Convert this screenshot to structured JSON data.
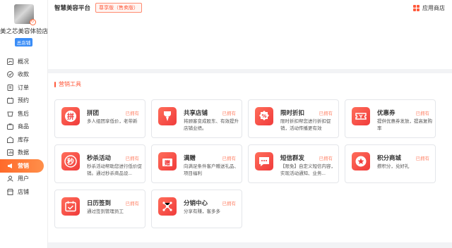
{
  "store": {
    "name": "美之芯美容体验店",
    "tag": "总店铺"
  },
  "nav": [
    {
      "label": "概况",
      "icon": "overview-icon"
    },
    {
      "label": "收款",
      "icon": "checkout-icon"
    },
    {
      "label": "订单",
      "icon": "order-icon"
    },
    {
      "label": "预约",
      "icon": "appointment-icon"
    },
    {
      "label": "售后",
      "icon": "after-sale-icon"
    },
    {
      "label": "商品",
      "icon": "goods-icon"
    },
    {
      "label": "库存",
      "icon": "stock-icon"
    },
    {
      "label": "数据",
      "icon": "data-icon"
    },
    {
      "label": "营销",
      "icon": "marketing-icon"
    },
    {
      "label": "用户",
      "icon": "user-icon"
    },
    {
      "label": "店铺",
      "icon": "shop-icon"
    }
  ],
  "header": {
    "platform": "智慧美容平台",
    "edition": "尊享版（售卖版）",
    "app_store": "应用商店"
  },
  "colors": {
    "accent": "#ff5a3c",
    "card_icon": "#f03b3b"
  },
  "marketing": {
    "title": "营销工具",
    "tools": [
      {
        "name": "拼团",
        "status": "已拥有",
        "desc": "多人组团享低价，老带新",
        "icon": "group-buy-icon"
      },
      {
        "name": "共享店铺",
        "status": "已拥有",
        "desc": "将顾客变成股东、有效提升店铺业绩。",
        "icon": "shared-shop-icon"
      },
      {
        "name": "限时折扣",
        "status": "已拥有",
        "desc": "限时折扣帮您进行折扣促销，活动传播更有效",
        "icon": "discount-icon"
      },
      {
        "name": "优惠券",
        "status": "已拥有",
        "desc": "提供优惠券发放，提高复购率",
        "icon": "coupon-icon"
      },
      {
        "name": "秒杀活动",
        "status": "已拥有",
        "desc": "秒杀活动帮助您进行低价促销。通过秒杀商品设...",
        "icon": "flash-sale-icon"
      },
      {
        "name": "满赠",
        "status": "已拥有",
        "desc": "向满足条件客户赠送礼品、项目福利",
        "icon": "gift-icon"
      },
      {
        "name": "短信群发",
        "status": "已拥有",
        "desc": "【限免】自定义短信内容，实现活动通知、业务...",
        "icon": "sms-icon"
      },
      {
        "name": "积分商城",
        "status": "已拥有",
        "desc": "攒积分，兑好礼",
        "icon": "points-mall-icon"
      },
      {
        "name": "日历签到",
        "status": "已拥有",
        "desc": "通过签到管理员工",
        "icon": "calendar-icon"
      },
      {
        "name": "分销中心",
        "status": "已拥有",
        "desc": "分享有赚，客多多",
        "icon": "distribution-icon"
      }
    ]
  }
}
